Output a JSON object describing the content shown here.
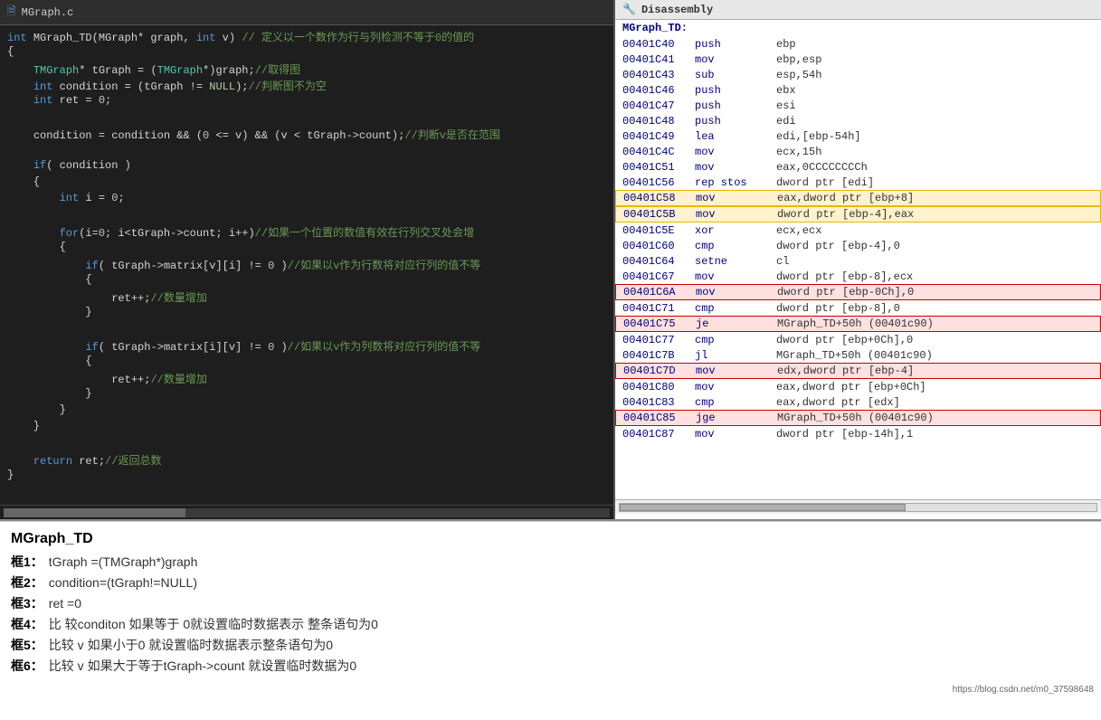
{
  "code_panel": {
    "title": "MGraph.c",
    "header_icon": "📄",
    "lines": [
      {
        "text": "int MGraph_TD(MGraph* graph, int v) // 定义以一个数作为行与列检测不等于0的值的",
        "type": "header"
      },
      {
        "text": "{",
        "type": "plain"
      },
      {
        "text": "    TMGraph* tGraph = (TMGraph*)graph;//取得图",
        "type": "code"
      },
      {
        "text": "    int condition = (tGraph != NULL);//判断图不为空",
        "type": "code"
      },
      {
        "text": "    int ret = 0;",
        "type": "code"
      },
      {
        "text": "",
        "type": "blank"
      },
      {
        "text": "    condition = condition && (0 <= v) && (v < tGraph->count);//判断v是否在范围",
        "type": "code"
      },
      {
        "text": "",
        "type": "blank"
      },
      {
        "text": "    if( condition )",
        "type": "code"
      },
      {
        "text": "    {",
        "type": "plain"
      },
      {
        "text": "        int i = 0;",
        "type": "code"
      },
      {
        "text": "",
        "type": "blank"
      },
      {
        "text": "        for(i=0; i<tGraph->count; i++)//如果一个位置的数值有效在行列交叉处会增",
        "type": "code"
      },
      {
        "text": "        {",
        "type": "plain"
      },
      {
        "text": "            if( tGraph->matrix[v][i] != 0 )//如果以v作为行数将对应行列的值不等",
        "type": "code"
      },
      {
        "text": "            {",
        "type": "plain"
      },
      {
        "text": "                ret++;//数量增加",
        "type": "code"
      },
      {
        "text": "            }",
        "type": "plain"
      },
      {
        "text": "",
        "type": "blank"
      },
      {
        "text": "            if( tGraph->matrix[i][v] != 0 )//如果以v作为列数将对应行列的值不等",
        "type": "code"
      },
      {
        "text": "            {",
        "type": "plain"
      },
      {
        "text": "                ret++;//数量增加",
        "type": "code"
      },
      {
        "text": "            }",
        "type": "plain"
      },
      {
        "text": "        }",
        "type": "plain"
      },
      {
        "text": "    }",
        "type": "plain"
      },
      {
        "text": "",
        "type": "blank"
      },
      {
        "text": "    return ret;//返回总数",
        "type": "code"
      },
      {
        "text": "}",
        "type": "plain"
      }
    ]
  },
  "disasm_panel": {
    "title": "Disassembly",
    "icon": "🔧",
    "section_label": "MGraph_TD:",
    "rows": [
      {
        "addr": "00401C40",
        "mnem": "push",
        "ops": "ebp",
        "highlight": "none"
      },
      {
        "addr": "00401C41",
        "mnem": "mov",
        "ops": "ebp,esp",
        "highlight": "none"
      },
      {
        "addr": "00401C43",
        "mnem": "sub",
        "ops": "esp,54h",
        "highlight": "none"
      },
      {
        "addr": "00401C46",
        "mnem": "push",
        "ops": "ebx",
        "highlight": "none"
      },
      {
        "addr": "00401C47",
        "mnem": "push",
        "ops": "esi",
        "highlight": "none"
      },
      {
        "addr": "00401C48",
        "mnem": "push",
        "ops": "edi",
        "highlight": "none"
      },
      {
        "addr": "00401C49",
        "mnem": "lea",
        "ops": "edi,[ebp-54h]",
        "highlight": "none"
      },
      {
        "addr": "00401C4C",
        "mnem": "mov",
        "ops": "ecx,15h",
        "highlight": "none"
      },
      {
        "addr": "00401C51",
        "mnem": "mov",
        "ops": "eax,0CCCCCCCCh",
        "highlight": "none"
      },
      {
        "addr": "00401C56",
        "mnem": "rep stos",
        "ops": "dword ptr [edi]",
        "highlight": "none"
      },
      {
        "addr": "00401C58",
        "mnem": "mov",
        "ops": "eax,dword ptr [ebp+8]",
        "highlight": "yellow"
      },
      {
        "addr": "00401C5B",
        "mnem": "mov",
        "ops": "dword ptr [ebp-4],eax",
        "highlight": "yellow"
      },
      {
        "addr": "00401C5E",
        "mnem": "xor",
        "ops": "ecx,ecx",
        "highlight": "none"
      },
      {
        "addr": "00401C60",
        "mnem": "cmp",
        "ops": "dword ptr [ebp-4],0",
        "highlight": "none"
      },
      {
        "addr": "00401C64",
        "mnem": "setne",
        "ops": "cl",
        "highlight": "none"
      },
      {
        "addr": "00401C67",
        "mnem": "mov",
        "ops": "dword ptr [ebp-8],ecx",
        "highlight": "none"
      },
      {
        "addr": "00401C6A",
        "mnem": "mov",
        "ops": "dword ptr [ebp-0Ch],0",
        "highlight": "red"
      },
      {
        "addr": "00401C71",
        "mnem": "cmp",
        "ops": "dword ptr [ebp-8],0",
        "highlight": "none"
      },
      {
        "addr": "00401C75",
        "mnem": "je",
        "ops": "MGraph_TD+50h (00401c90)",
        "highlight": "red"
      },
      {
        "addr": "00401C77",
        "mnem": "cmp",
        "ops": "dword ptr [ebp+0Ch],0",
        "highlight": "none"
      },
      {
        "addr": "00401C7B",
        "mnem": "jl",
        "ops": "MGraph_TD+50h (00401c90)",
        "highlight": "none"
      },
      {
        "addr": "00401C7D",
        "mnem": "mov",
        "ops": "edx,dword ptr [ebp-4]",
        "highlight": "red"
      },
      {
        "addr": "00401C80",
        "mnem": "mov",
        "ops": "eax,dword ptr [ebp+0Ch]",
        "highlight": "none"
      },
      {
        "addr": "00401C83",
        "mnem": "cmp",
        "ops": "eax,dword ptr [edx]",
        "highlight": "none"
      },
      {
        "addr": "00401C85",
        "mnem": "jge",
        "ops": "MGraph_TD+50h (00401c90)",
        "highlight": "red"
      },
      {
        "addr": "00401C87",
        "mnem": "mov",
        "ops": "dword ptr [ebp-14h],1",
        "highlight": "none"
      }
    ]
  },
  "annotations": {
    "title": "MGraph_TD",
    "items": [
      {
        "label": "框1：",
        "text": "tGraph =(TMGraph*)graph"
      },
      {
        "label": "框2：",
        "text": "condition=(tGraph!=NULL)"
      },
      {
        "label": "框3：",
        "text": "ret =0"
      },
      {
        "label": "框4：",
        "text": "比 较conditon 如果等于 0就设置临时数据表示 整条语句为0"
      },
      {
        "label": "框5：",
        "text": "比较 v 如果小于0 就设置临时数据表示整条语句为0"
      },
      {
        "label": "框6：",
        "text": "比较 v 如果大于等于tGraph->count  就设置临时数据为0"
      }
    ]
  },
  "watermark": "https://blog.csdn.net/m0_37598648"
}
